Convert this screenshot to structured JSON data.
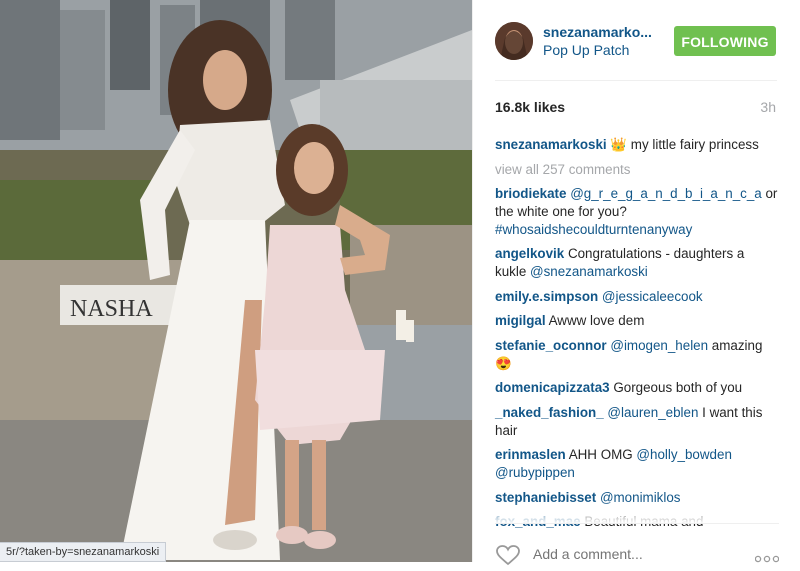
{
  "status_url": "5r/?taken-by=snezanamarkoski",
  "post": {
    "username": "snezanamarko...",
    "location": "Pop Up Patch",
    "follow_label": "FOLLOWING",
    "likes": "16.8k likes",
    "time": "3h",
    "caption_user": "snezanamarkoski",
    "caption_emoji": "👑",
    "caption_text": " my little fairy princess",
    "view_all": "view all 257 comments",
    "photo_sign": "NASHA"
  },
  "comments": [
    {
      "user": "briodiekate",
      "mention": "@g_r_e_g_a_n_d_b_i_a_n_c_a",
      "text": " or the white one for you? ",
      "tag": "#whosaidshecouldturntenanyway"
    },
    {
      "user": "angelkovik",
      "text": " Congratulations - daughters a kukle ",
      "mention2": "@snezanamarkoski"
    },
    {
      "user": "emily.e.simpson",
      "mention": " @jessicaleecook"
    },
    {
      "user": "migilgal",
      "text": " Awww love dem"
    },
    {
      "user": "stefanie_oconnor",
      "mention": " @imogen_helen",
      "text": " amazing 😍"
    },
    {
      "user": "domenicapizzata3",
      "text": " Gorgeous both of you"
    },
    {
      "user": "_naked_fashion_",
      "mention": " @lauren_eblen",
      "text": " I want this hair"
    },
    {
      "user": "erinmaslen",
      "text": " AHH OMG ",
      "mention2": "@holly_bowden @rubypippen"
    },
    {
      "user": "stephaniebisset",
      "mention": " @monimiklos"
    },
    {
      "user": "fox_and_mae",
      "text": " Beautiful mama and"
    }
  ],
  "footer": {
    "add_comment_placeholder": "Add a comment..."
  },
  "icons": {
    "heart": "heart-icon",
    "more": "more-options-icon"
  },
  "colors": {
    "follow_green": "#70c050",
    "link_blue": "#125688"
  }
}
